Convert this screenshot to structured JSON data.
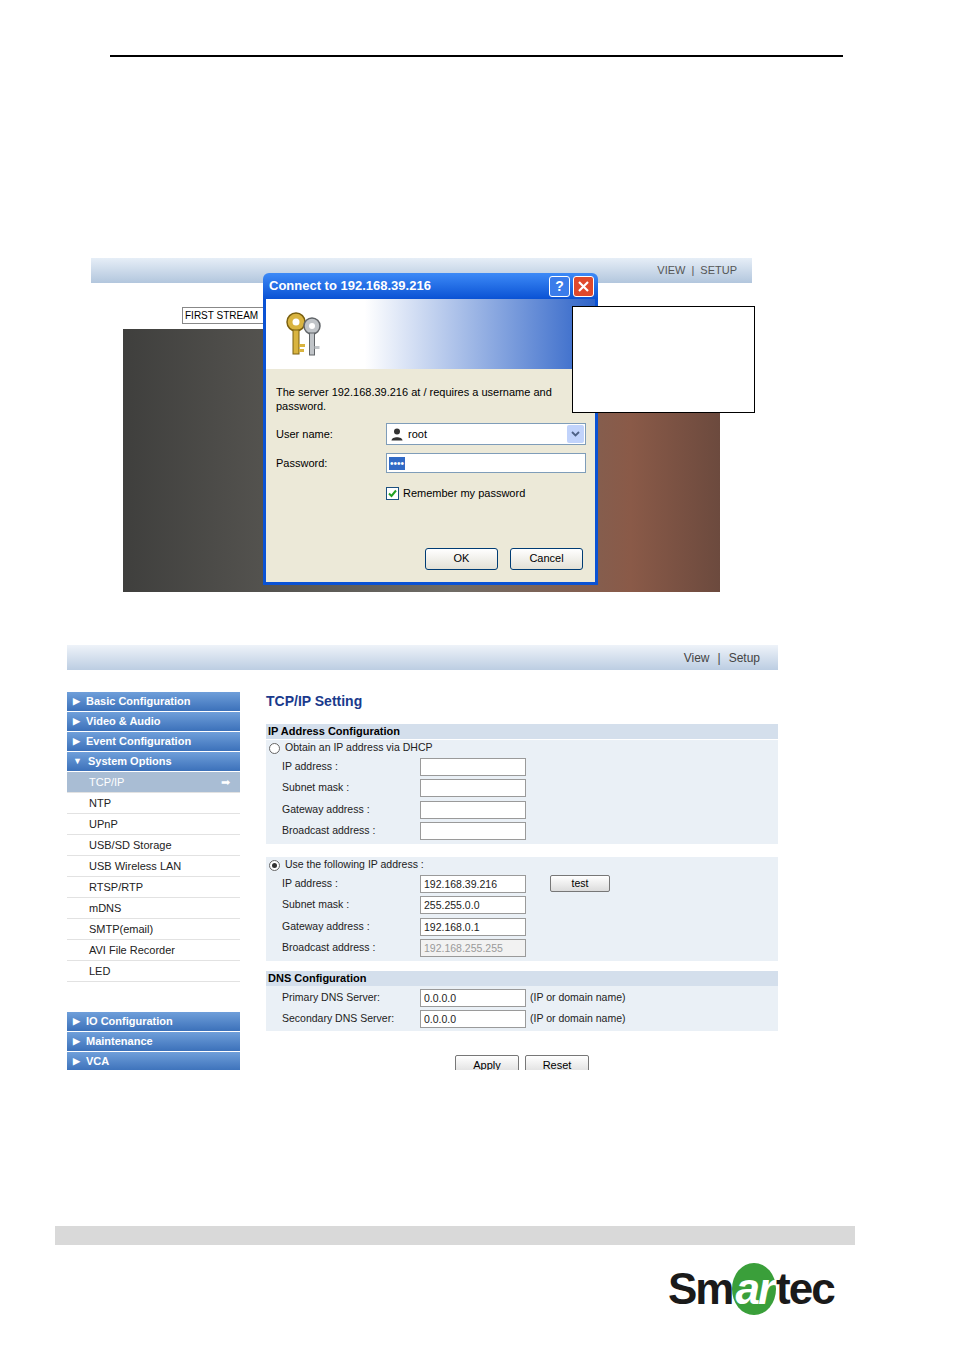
{
  "login_screenshot": {
    "nav": [
      "VIEW",
      "|",
      "SETUP"
    ],
    "stream_select": "FIRST STREAM",
    "dialog": {
      "title": "Connect to 192.168.39.216",
      "help_button": "?",
      "message": "The server 192.168.39.216 at / requires a username and password.",
      "username_label": "User name:",
      "username": "root",
      "password_label": "Password:",
      "password": "••••",
      "remember": {
        "label": "Remember my password",
        "checked": true
      },
      "buttons": [
        "OK",
        "Cancel"
      ]
    }
  },
  "setup_screenshot": {
    "nav": [
      "View",
      "|",
      "Setup"
    ],
    "sidebar": {
      "selected_marker": "➡",
      "sections": [
        {
          "icon": "▶",
          "label": "Basic Configuration",
          "expanded": false
        },
        {
          "icon": "▶",
          "label": "Video & Audio",
          "expanded": false
        },
        {
          "icon": "▶",
          "label": "Event Configuration",
          "expanded": false
        },
        {
          "icon": "▼",
          "label": "System Options",
          "expanded": true,
          "items": [
            {
              "label": "TCP/IP",
              "selected": true
            },
            {
              "label": "NTP",
              "selected": false
            },
            {
              "label": "UPnP",
              "selected": false
            },
            {
              "label": "USB/SD Storage",
              "selected": false
            },
            {
              "label": "USB Wireless LAN",
              "selected": false
            },
            {
              "label": "RTSP/RTP",
              "selected": false
            },
            {
              "label": "mDNS",
              "selected": false
            },
            {
              "label": "SMTP(email)",
              "selected": false
            },
            {
              "label": "AVI File Recorder",
              "selected": false
            },
            {
              "label": "LED",
              "selected": false
            }
          ]
        },
        {
          "icon": "▶",
          "label": "IO Configuration",
          "expanded": false
        },
        {
          "icon": "▶",
          "label": "Maintenance",
          "expanded": false
        },
        {
          "icon": "▶",
          "label": "VCA",
          "expanded": false
        }
      ]
    },
    "form": {
      "title": "TCP/IP Setting",
      "ip_section": "IP Address Configuration",
      "modes": [
        {
          "label": "Obtain an IP address via DHCP",
          "selected": false,
          "fields": [
            {
              "label": "IP address :",
              "value": "",
              "disabled": false
            },
            {
              "label": "Subnet mask :",
              "value": "",
              "disabled": false
            },
            {
              "label": "Gateway address :",
              "value": "",
              "disabled": false
            },
            {
              "label": "Broadcast address :",
              "value": "",
              "disabled": false
            }
          ]
        },
        {
          "label": "Use the following IP address :",
          "selected": true,
          "fields": [
            {
              "label": "IP address :",
              "value": "192.168.39.216",
              "disabled": false,
              "button": "test"
            },
            {
              "label": "Subnet mask :",
              "value": "255.255.0.0",
              "disabled": false
            },
            {
              "label": "Gateway address :",
              "value": "192.168.0.1",
              "disabled": false
            },
            {
              "label": "Broadcast address :",
              "value": "192.168.255.255",
              "disabled": true
            }
          ]
        }
      ],
      "dns_section": "DNS Configuration",
      "dns_fields": [
        {
          "label": "Primary DNS Server:",
          "value": "0.0.0.0",
          "hint": "(IP or domain name)"
        },
        {
          "label": "Secondary DNS Server:",
          "value": "0.0.0.0",
          "hint": "(IP or domain name)"
        }
      ],
      "buttons": [
        "Apply",
        "Reset"
      ]
    }
  },
  "logo": [
    {
      "text": "Sm",
      "accent": false
    },
    {
      "text": "ar",
      "accent": true
    },
    {
      "text": "tec",
      "accent": false
    }
  ]
}
